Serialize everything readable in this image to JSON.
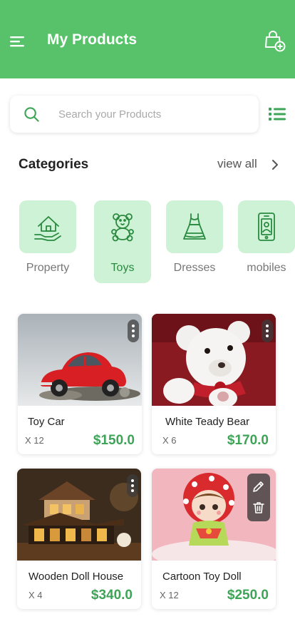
{
  "header": {
    "title": "My Products",
    "menu_icon": "hamburger-menu-icon",
    "bag_icon": "shopping-bag-add-icon",
    "background": "#57c26a"
  },
  "search": {
    "placeholder": "Search your Products",
    "value": "",
    "icon": "search-icon"
  },
  "categories": {
    "title": "Categories",
    "view_all": "view all",
    "items": [
      {
        "label": "Property",
        "icon": "house-in-hand-icon",
        "active": false
      },
      {
        "label": "Toys",
        "icon": "teddy-bear-icon",
        "active": true
      },
      {
        "label": "Dresses",
        "icon": "dress-icon",
        "active": false
      },
      {
        "label": "mobiles",
        "icon": "mobile-phone-icon",
        "active": false
      }
    ]
  },
  "products": [
    {
      "name": "Toy Car",
      "qty": "X 12",
      "price": "$150.0"
    },
    {
      "name": "White Teady Bear",
      "qty": "X 6",
      "price": "$170.0"
    },
    {
      "name": "Wooden Doll House",
      "qty": "X 4",
      "price": "$340.0"
    },
    {
      "name": "Cartoon Toy Doll",
      "qty": "X 12",
      "price": "$250.0"
    }
  ],
  "colors": {
    "accent": "#57c26a",
    "price": "#3ea457",
    "tile": "#cdf2d5"
  }
}
